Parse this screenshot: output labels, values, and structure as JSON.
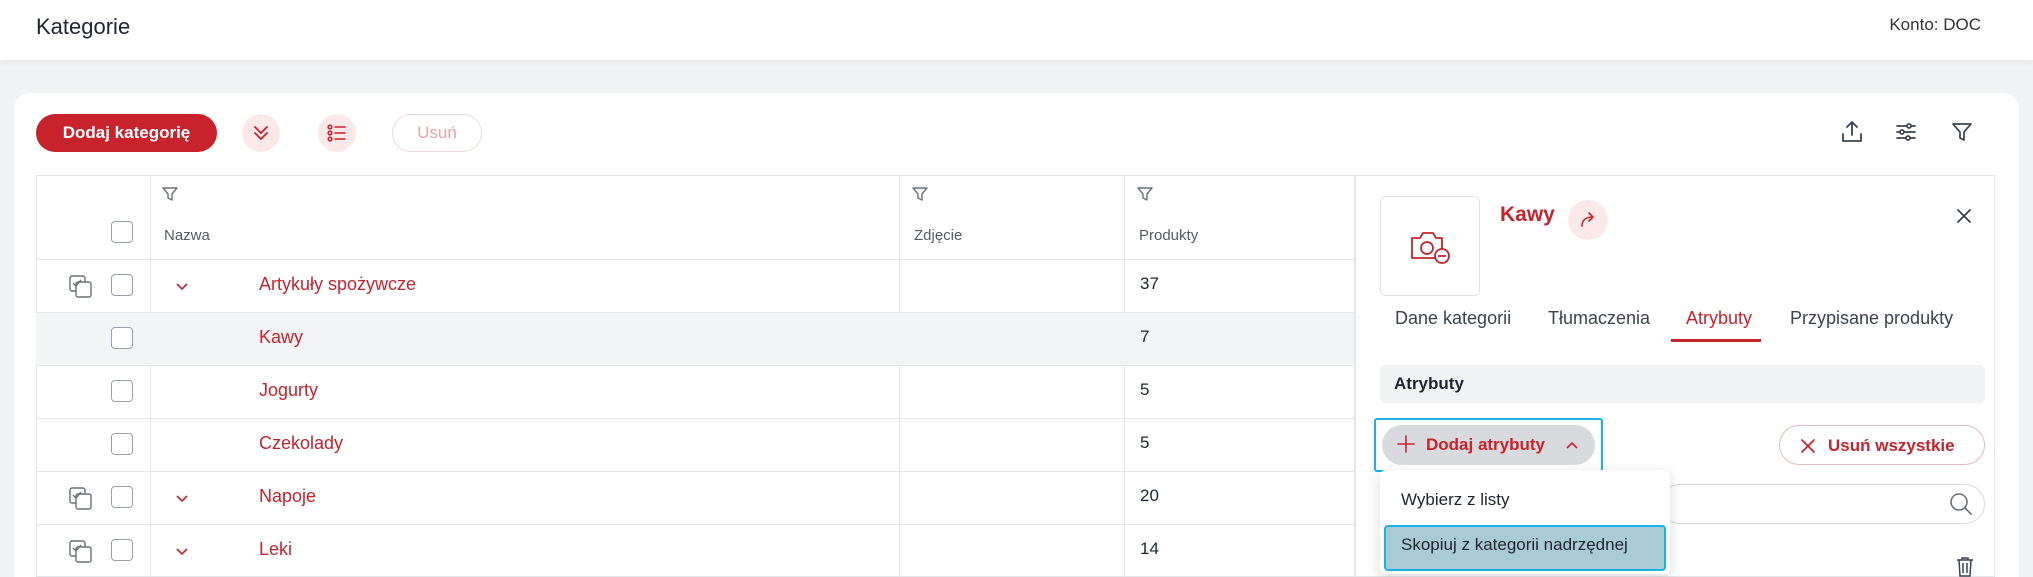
{
  "header": {
    "title": "Kategorie",
    "account": "Konto: DOC"
  },
  "toolbar": {
    "add_category": "Dodaj kategorię",
    "delete": "Usuń",
    "icons": [
      "expand-all-icon",
      "list-icon",
      "upload-icon",
      "sliders-icon",
      "filter-icon"
    ]
  },
  "table": {
    "columns": {
      "name": "Nazwa",
      "photo": "Zdjęcie",
      "products": "Produkty"
    },
    "rows": [
      {
        "name": "Artykuły spożywcze",
        "products": "37",
        "expandable": true
      },
      {
        "name": "Kawy",
        "products": "7",
        "selected": true
      },
      {
        "name": "Jogurty",
        "products": "5"
      },
      {
        "name": "Czekolady",
        "products": "5"
      },
      {
        "name": "Napoje",
        "products": "20",
        "expandable": true
      },
      {
        "name": "Leki",
        "products": "14",
        "expandable": true
      }
    ]
  },
  "panel": {
    "title": "Kawy",
    "tabs": [
      "Dane kategorii",
      "Tłumaczenia",
      "Atrybuty",
      "Przypisane produkty"
    ],
    "active_tab": "Atrybuty",
    "section_title": "Atrybuty",
    "add_attributes": "Dodaj atrybuty",
    "remove_all": "Usuń wszystkie",
    "dropdown": [
      "Wybierz z listy",
      "Skopiuj z kategorii nadrzędnej"
    ]
  },
  "colors": {
    "accent": "#c8232c",
    "focus": "#1bb3e5"
  }
}
